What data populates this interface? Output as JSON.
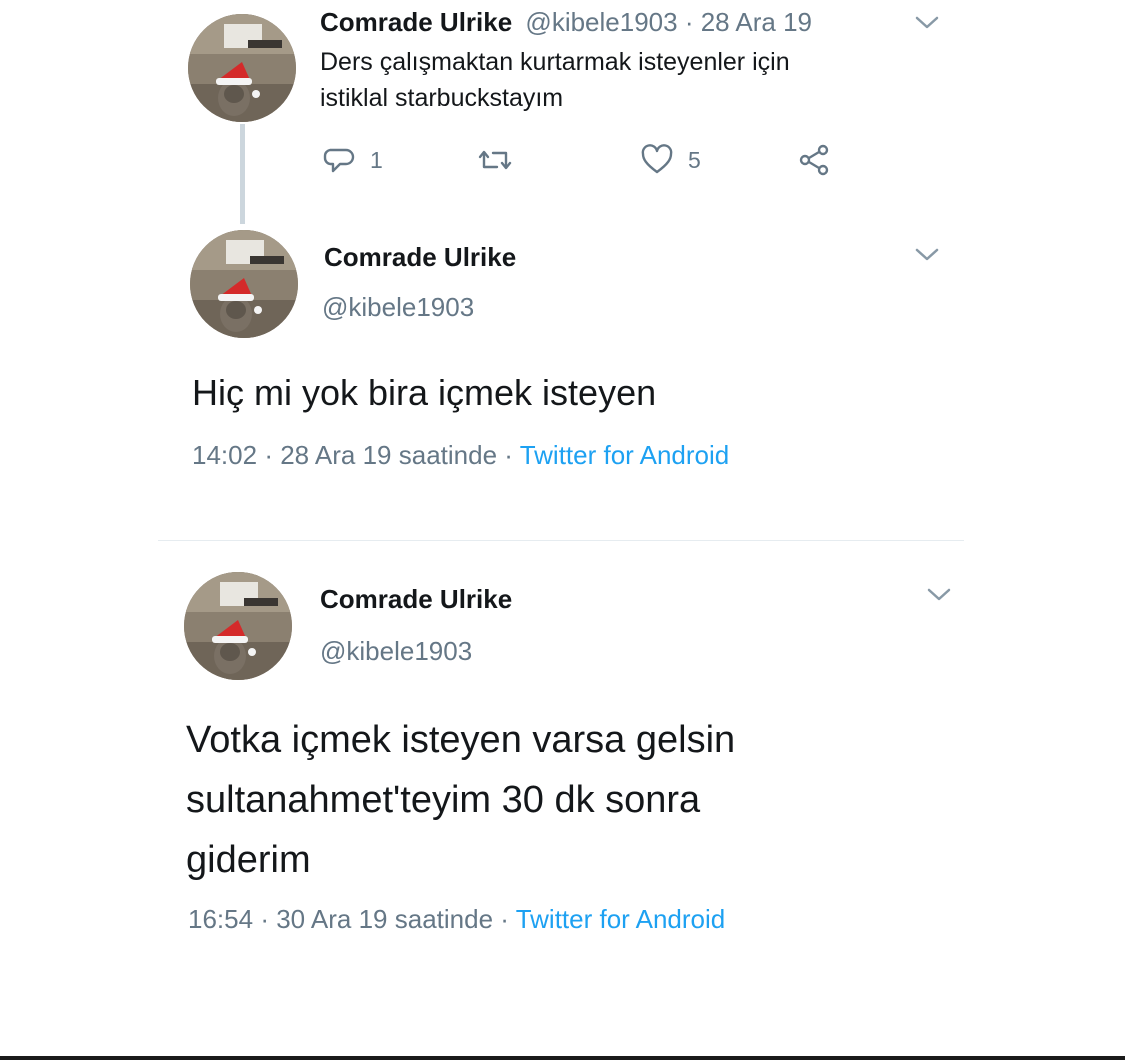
{
  "tweets": [
    {
      "name": "Comrade Ulrike",
      "handle": "@kibele1903",
      "date": "28 Ara 19",
      "meta_separator": " · ",
      "text": "Ders çalışmaktan kurtarmak isteyenler için\nistiklal starbuckstayım",
      "replies": "1",
      "likes": "5"
    },
    {
      "name": "Comrade Ulrike",
      "handle": "@kibele1903",
      "text": "Hiç mi yok bira içmek isteyen",
      "time": "14:02",
      "date": "28 Ara 19 saatinde",
      "source": "Twitter for Android"
    },
    {
      "name": "Comrade Ulrike",
      "handle": "@kibele1903",
      "text": "Votka içmek isteyen varsa gelsin\nsultanahmet'teyim 30 dk sonra\ngiderim",
      "time": "16:54",
      "date": "30 Ara 19 saatinde",
      "source": "Twitter for Android"
    }
  ],
  "icons": {
    "reply": "reply-icon",
    "retweet": "retweet-icon",
    "like": "heart-icon",
    "share": "share-icon",
    "menu": "chevron-down-icon",
    "avatar": "avatar-cat-santa-hat"
  },
  "colors": {
    "text": "#14171a",
    "secondary": "#657786",
    "link": "#1da1f2",
    "divider": "#e6ecf0",
    "thread_line": "#ccd6dd"
  }
}
